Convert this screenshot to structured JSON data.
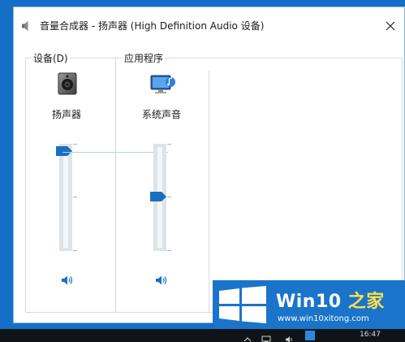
{
  "window": {
    "title": "音量合成器 - 扬声器 (High Definition Audio 设备)"
  },
  "device_section": {
    "label": "设备(D)",
    "channel": {
      "name": "扬声器",
      "icon": "speaker-device-icon",
      "volume_percent": 100
    }
  },
  "apps_section": {
    "label": "应用程序",
    "channels": [
      {
        "name": "系统声音",
        "icon": "system-sounds-icon",
        "volume_percent": 53
      }
    ]
  },
  "taskbar": {
    "clock": "16:47"
  },
  "watermark": {
    "title_part1": "Win10 ",
    "title_part2": "之家",
    "url": "www.win10xitong.com"
  },
  "colors": {
    "accent": "#1a6fc0",
    "desktop": "#1470c6",
    "watermark_accent": "#ffe04b"
  }
}
